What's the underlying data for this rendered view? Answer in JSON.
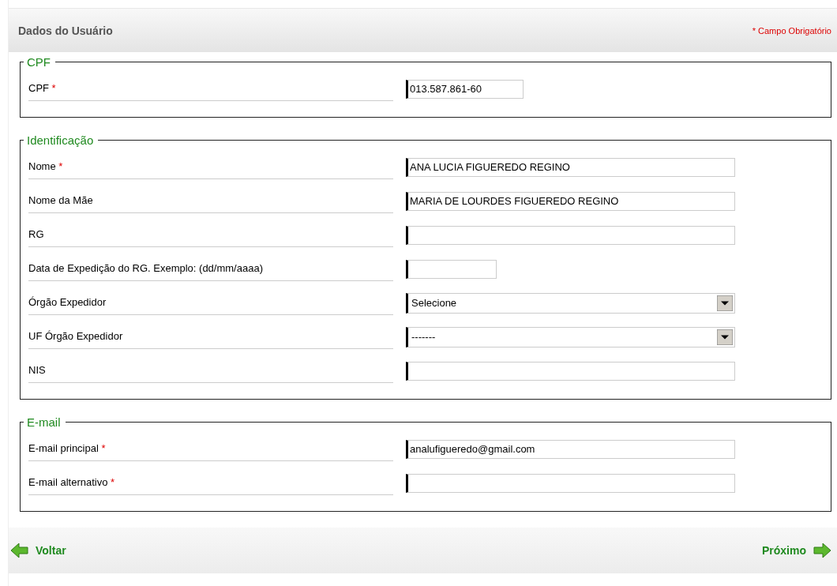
{
  "header": {
    "title": "Dados do Usuário",
    "note": "* Campo Obrigatório"
  },
  "required_mark": "*",
  "sections": [
    {
      "title": "CPF",
      "fields": [
        {
          "label": "CPF",
          "required": true,
          "kind": "short",
          "value": "013.587.861-60"
        }
      ]
    },
    {
      "title": "Identificação",
      "fields": [
        {
          "label": "Nome",
          "required": true,
          "kind": "text",
          "value": "ANA LUCIA FIGUEREDO REGINO"
        },
        {
          "label": "Nome da Mãe",
          "required": false,
          "kind": "text",
          "value": "MARIA DE LOURDES FIGUEREDO REGINO"
        },
        {
          "label": "RG",
          "required": false,
          "kind": "text"
        },
        {
          "label": "Data de Expedição do RG. Exemplo: (dd/mm/aaaa)",
          "required": false,
          "kind": "date"
        },
        {
          "label": "Órgão Expedidor",
          "required": false,
          "kind": "select",
          "value": "Selecione"
        },
        {
          "label": "UF Órgão Expedidor",
          "required": false,
          "kind": "select",
          "value": "-------"
        },
        {
          "label": "NIS",
          "required": false,
          "kind": "text"
        }
      ]
    },
    {
      "title": "E-mail",
      "fields": [
        {
          "label": "E-mail principal",
          "required": true,
          "kind": "text",
          "value": "analufigueredo@gmail.com"
        },
        {
          "label": "E-mail alternativo",
          "required": true,
          "kind": "text"
        }
      ]
    }
  ],
  "footer": {
    "back": "Voltar",
    "next": "Próximo"
  }
}
